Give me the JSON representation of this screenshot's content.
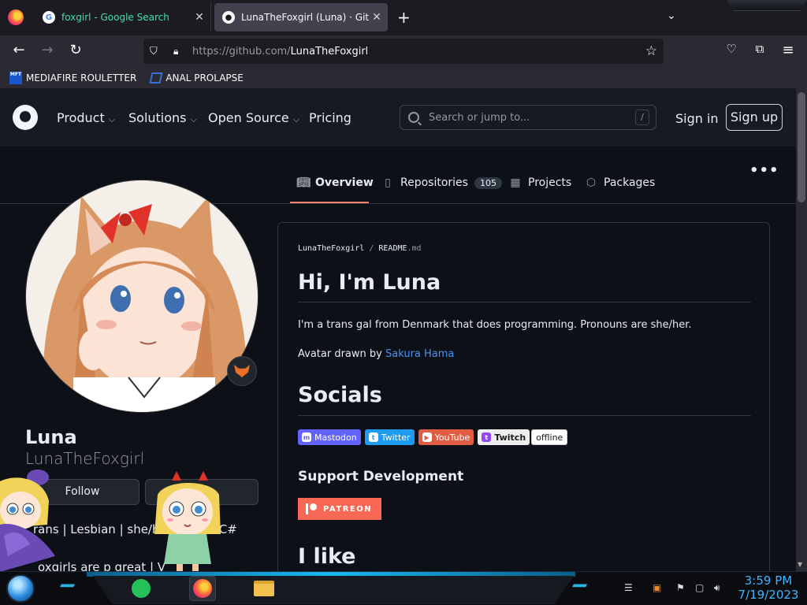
{
  "browser": {
    "tabs": [
      {
        "title": "foxgirl - Google Search",
        "favicon": "google-icon",
        "active": false
      },
      {
        "title": "LunaTheFoxgirl (Luna) · GitHub",
        "favicon": "github-icon",
        "active": true
      }
    ],
    "new_tab_glyph": "+",
    "close_glyph": "✕",
    "url_host": "https://github.com/",
    "url_path": "LunaTheFoxgirl",
    "bookmarks": [
      {
        "label": "MEDIAFIRE ROULETTER",
        "icon": "mediafire-icon",
        "icon_text": "MFT"
      },
      {
        "label": "ANAL PROLAPSE",
        "icon": "sigma-bookmark-icon"
      }
    ]
  },
  "github": {
    "nav": [
      {
        "label": "Product",
        "dropdown": true
      },
      {
        "label": "Solutions",
        "dropdown": true
      },
      {
        "label": "Open Source",
        "dropdown": true
      },
      {
        "label": "Pricing",
        "dropdown": false
      }
    ],
    "search_placeholder": "Search or jump to...",
    "search_shortcut": "/",
    "sign_in": "Sign in",
    "sign_up": "Sign up",
    "profile_tabs": [
      {
        "label": "Overview",
        "icon": "book-icon",
        "active": true
      },
      {
        "label": "Repositories",
        "icon": "repo-icon",
        "count": "105"
      },
      {
        "label": "Projects",
        "icon": "table-icon"
      },
      {
        "label": "Packages",
        "icon": "package-icon"
      }
    ],
    "kebab": "•••",
    "profile": {
      "name": "Luna",
      "login": "LunaTheFoxgirl",
      "follow": "Follow",
      "bio_line1": "rans | Lesbian | she/he",
      "bio_line1b": "C# dev",
      "bio_line2": "oxgirls are p great | V"
    },
    "readme": {
      "path_owner": "LunaTheFoxgirl",
      "path_sep": "/",
      "path_file": "README",
      "path_ext": ".md",
      "h1": "Hi, I'm Luna",
      "intro": "I'm a trans gal from Denmark that does programming. Pronouns are she/her.",
      "avatar_prefix": "Avatar drawn by ",
      "avatar_artist": "Sakura Hama",
      "socials_heading": "Socials",
      "badges": [
        {
          "label": "Mastodon",
          "color": "#6364ff",
          "icon_text": "m"
        },
        {
          "label": "Twitter",
          "color": "#1d9bf0",
          "icon_text": "t"
        },
        {
          "label": "YouTube",
          "color": "#e05d44",
          "icon_text": "▶"
        },
        {
          "label": "Twitch",
          "color": "#eeeeee",
          "icon_text": "t"
        },
        {
          "label": "offline",
          "color": "#ffffff"
        }
      ],
      "support_heading": "Support Development",
      "patreon_label": "PATREON",
      "like_heading": "I like"
    }
  },
  "taskbar": {
    "time": "3:59 PM",
    "date": "7/19/2023",
    "apps": [
      "notes-icon",
      "firefox-icon",
      "file-explorer-icon"
    ]
  },
  "colors": {
    "accent_tab": "#f78166",
    "link": "#4493f8",
    "bg": "#0d1117",
    "header": "#161b22"
  }
}
